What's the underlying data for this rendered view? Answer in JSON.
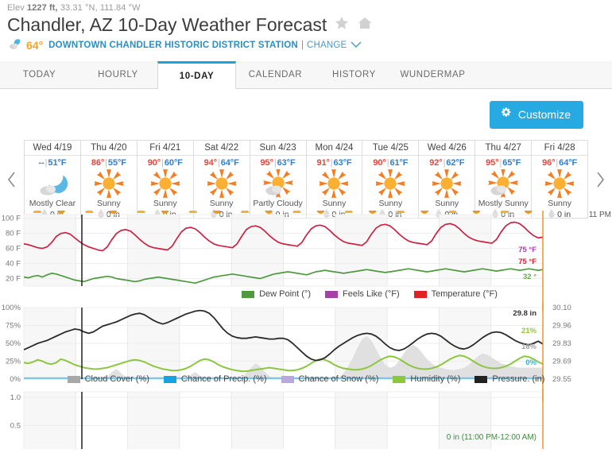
{
  "header": {
    "elev_prefix": "Elev",
    "elev_value": "1227 ft,",
    "coords": "33.31 °N, 111.84 °W",
    "title": "Chandler, AZ 10-Day Weather Forecast",
    "star_icon": "star-icon",
    "home_icon": "home-icon",
    "current_temp": "64°",
    "station_name": "DOWNTOWN CHANDLER HISTORIC DISTRICT STATION",
    "pipe": "|",
    "change_label": "CHANGE",
    "current_icon": "moon-cloud-icon"
  },
  "tabs": [
    {
      "label": "TODAY",
      "active": false
    },
    {
      "label": "HOURLY",
      "active": false
    },
    {
      "label": "10-DAY",
      "active": true
    },
    {
      "label": "CALENDAR",
      "active": false
    },
    {
      "label": "HISTORY",
      "active": false
    },
    {
      "label": "WUNDERMAP",
      "active": false
    }
  ],
  "toolbar": {
    "customize_label": "Customize",
    "gear_icon": "gear-icon"
  },
  "forecast": {
    "prev_label": "‹",
    "next_label": "›",
    "now_label": "11 PM",
    "days": [
      {
        "name": "Wed 4/19",
        "high": "--",
        "low": "51°F",
        "cond": "Mostly Clear",
        "precip": "0 in",
        "icon": "moon-cloud-icon",
        "high_na": true
      },
      {
        "name": "Thu 4/20",
        "high": "86°",
        "low": "55°F",
        "cond": "Sunny",
        "precip": "0 in",
        "icon": "sun-icon",
        "high_na": false
      },
      {
        "name": "Fri 4/21",
        "high": "90°",
        "low": "60°F",
        "cond": "Sunny",
        "precip": "0 in",
        "icon": "sun-icon",
        "high_na": false
      },
      {
        "name": "Sat 4/22",
        "high": "94°",
        "low": "64°F",
        "cond": "Sunny",
        "precip": "0 in",
        "icon": "sun-icon",
        "high_na": false
      },
      {
        "name": "Sun 4/23",
        "high": "95°",
        "low": "63°F",
        "cond": "Partly Cloudy",
        "precip": "0 in",
        "icon": "sun-cloud-icon",
        "high_na": false
      },
      {
        "name": "Mon 4/24",
        "high": "91°",
        "low": "63°F",
        "cond": "Sunny",
        "precip": "0 in",
        "icon": "sun-icon",
        "high_na": false
      },
      {
        "name": "Tue 4/25",
        "high": "90°",
        "low": "61°F",
        "cond": "Sunny",
        "precip": "0 in",
        "icon": "sun-icon",
        "high_na": false
      },
      {
        "name": "Wed 4/26",
        "high": "92°",
        "low": "62°F",
        "cond": "Sunny",
        "precip": "0 in",
        "icon": "sun-icon",
        "high_na": false
      },
      {
        "name": "Thu 4/27",
        "high": "95°",
        "low": "65°F",
        "cond": "Mostly Sunny",
        "precip": "0 in",
        "icon": "sun-cloud-icon",
        "high_na": false
      },
      {
        "name": "Fri 4/28",
        "high": "96°",
        "low": "64°F",
        "cond": "Sunny",
        "precip": "0 in",
        "icon": "sun-icon",
        "high_na": false
      }
    ]
  },
  "chart_data": [
    {
      "id": "temperature",
      "type": "line",
      "title": "",
      "xlabel": "",
      "ylabel": "",
      "ylim": [
        10,
        105
      ],
      "yticks": [
        "100 F",
        "80 F",
        "60 F",
        "40 F",
        "20 F"
      ],
      "ytick_values": [
        100,
        80,
        60,
        40,
        20
      ],
      "grid": true,
      "legend_position": "bottom",
      "legend": [
        {
          "name": "Dew Point (°)",
          "color": "#4e9a3e"
        },
        {
          "name": "Feels Like (°F)",
          "color": "#a83fa8"
        },
        {
          "name": "Temperature (°F)",
          "color": "#e02222"
        }
      ],
      "end_labels": [
        {
          "text": "75 °F",
          "color": "#a83fa8",
          "series": "Feels Like (°F)"
        },
        {
          "text": "75 °F",
          "color": "#d02030",
          "series": "Temperature (°F)"
        },
        {
          "text": "32 °",
          "color": "#6aa84f",
          "series": "Dew Point (°)"
        }
      ],
      "series": [
        {
          "name": "Temperature (°F)",
          "color": "#cc2244",
          "values": [
            66,
            65,
            63,
            61,
            60,
            62,
            68,
            76,
            80,
            81,
            79,
            74,
            69,
            65,
            62,
            60,
            58,
            57,
            62,
            72,
            80,
            84,
            85,
            83,
            78,
            72,
            67,
            63,
            61,
            60,
            59,
            58,
            63,
            73,
            82,
            87,
            88,
            86,
            81,
            75,
            70,
            66,
            64,
            63,
            62,
            61,
            66,
            76,
            85,
            89,
            90,
            88,
            83,
            77,
            72,
            68,
            66,
            65,
            64,
            63,
            68,
            78,
            86,
            90,
            91,
            89,
            84,
            78,
            73,
            69,
            67,
            66,
            65,
            64,
            69,
            79,
            87,
            91,
            92,
            90,
            85,
            79,
            74,
            70,
            68,
            67,
            66,
            65,
            70,
            80,
            88,
            92,
            93,
            91,
            86,
            80,
            75,
            72,
            70,
            69,
            68,
            67,
            72,
            82,
            90,
            94,
            95,
            93,
            88,
            82,
            77,
            74,
            75
          ]
        },
        {
          "name": "Dew Point (°)",
          "color": "#4e9a3e",
          "values": [
            22,
            21,
            23,
            24,
            22,
            25,
            27,
            26,
            24,
            22,
            20,
            18,
            17,
            16,
            18,
            20,
            21,
            22,
            23,
            22,
            20,
            19,
            18,
            17,
            16,
            17,
            19,
            20,
            21,
            22,
            21,
            20,
            19,
            18,
            17,
            16,
            15,
            14,
            16,
            18,
            20,
            22,
            23,
            24,
            25,
            26,
            25,
            24,
            23,
            22,
            21,
            20,
            22,
            24,
            26,
            27,
            28,
            29,
            28,
            27,
            26,
            25,
            27,
            29,
            30,
            31,
            30,
            29,
            28,
            27,
            28,
            29,
            30,
            31,
            32,
            31,
            30,
            29,
            28,
            29,
            30,
            31,
            32,
            33,
            32,
            31,
            30,
            29,
            30,
            31,
            32,
            33,
            32,
            31,
            30,
            29,
            30,
            31,
            32,
            33,
            32,
            31,
            30,
            31,
            32,
            33,
            32,
            31,
            32,
            33,
            32,
            31,
            32
          ]
        }
      ]
    },
    {
      "id": "conditions",
      "type": "line",
      "title": "",
      "ylim": [
        0,
        100
      ],
      "yticks": [
        "100%",
        "75%",
        "50%",
        "25%",
        "0%"
      ],
      "ytick_values": [
        100,
        75,
        50,
        25,
        0
      ],
      "y2ticks": [
        "30.10",
        "29.96",
        "29.83",
        "29.69",
        "29.55"
      ],
      "y2tick_values": [
        30.1,
        29.96,
        29.83,
        29.69,
        29.55
      ],
      "grid": true,
      "legend_position": "bottom",
      "legend": [
        {
          "name": "Cloud Cover (%)",
          "color": "#a8a8a8"
        },
        {
          "name": "Chance of Precip. (%)",
          "color": "#17a3dc"
        },
        {
          "name": "Chance of Snow (%)",
          "color": "#b9a8e0"
        },
        {
          "name": "Humidity (%)",
          "color": "#8dc63f"
        },
        {
          "name": "Pressure. (in)",
          "color": "#222222"
        }
      ],
      "end_labels": [
        {
          "text": "29.8 in",
          "color": "#333333",
          "series": "Pressure. (in)"
        },
        {
          "text": "21%",
          "color": "#8dc63f",
          "series": "Humidity (%)"
        },
        {
          "text": "16%",
          "color": "#a0a0a0",
          "series": "Cloud Cover (%)"
        },
        {
          "text": "0%",
          "color": "#29b6e8",
          "series": "Chance of Precip. (%)"
        }
      ],
      "series": [
        {
          "name": "Pressure. (in)",
          "color": "#333333",
          "values": [
            41,
            44,
            47,
            50,
            52,
            54,
            57,
            60,
            63,
            66,
            68,
            70,
            69,
            66,
            64,
            66,
            70,
            74,
            76,
            78,
            80,
            83,
            86,
            89,
            91,
            92,
            90,
            86,
            82,
            79,
            77,
            79,
            82,
            85,
            88,
            91,
            93,
            95,
            96,
            95,
            92,
            86,
            78,
            70,
            64,
            60,
            58,
            57,
            57,
            58,
            59,
            58,
            57,
            56,
            56,
            57,
            57,
            55,
            50,
            44,
            38,
            32,
            28,
            26,
            27,
            30,
            35,
            41,
            46,
            50,
            54,
            58,
            61,
            63,
            64,
            63,
            60,
            55,
            49,
            44,
            41,
            40,
            42,
            46,
            51,
            56,
            60,
            63,
            64,
            63,
            60,
            55,
            50,
            46,
            43,
            42,
            44,
            48,
            53,
            58,
            62,
            65,
            66,
            65,
            62,
            58,
            54,
            51,
            49,
            48,
            50,
            53,
            49
          ]
        },
        {
          "name": "Humidity (%)",
          "color": "#8dc63f",
          "values": [
            23,
            22,
            24,
            27,
            25,
            22,
            21,
            23,
            28,
            26,
            23,
            20,
            18,
            16,
            15,
            14,
            14,
            15,
            16,
            18,
            20,
            22,
            24,
            26,
            27,
            26,
            24,
            21,
            18,
            16,
            14,
            13,
            12,
            12,
            13,
            15,
            18,
            22,
            26,
            28,
            27,
            24,
            20,
            17,
            15,
            13,
            12,
            11,
            11,
            12,
            13,
            14,
            15,
            16,
            15,
            14,
            13,
            12,
            12,
            13,
            15,
            18,
            22,
            26,
            28,
            27,
            24,
            20,
            17,
            15,
            14,
            13,
            13,
            14,
            16,
            19,
            23,
            27,
            30,
            32,
            31,
            28,
            24,
            20,
            17,
            15,
            14,
            14,
            15,
            17,
            20,
            24,
            28,
            31,
            33,
            32,
            29,
            25,
            21,
            18,
            16,
            15,
            15,
            16,
            18,
            21,
            25,
            29,
            32,
            31,
            28,
            24,
            21
          ]
        },
        {
          "name": "Cloud Cover (%)",
          "color": "#c4c4c4",
          "values": [
            0,
            0,
            0,
            0,
            0,
            0,
            0,
            0,
            0,
            0,
            0,
            0,
            0,
            0,
            0,
            0,
            0,
            0,
            3,
            10,
            14,
            8,
            3,
            0,
            0,
            0,
            0,
            0,
            0,
            0,
            0,
            0,
            0,
            0,
            0,
            2,
            6,
            10,
            5,
            2,
            0,
            0,
            0,
            0,
            0,
            0,
            0,
            2,
            8,
            16,
            22,
            18,
            10,
            4,
            0,
            0,
            0,
            0,
            0,
            0,
            0,
            0,
            0,
            0,
            0,
            0,
            0,
            0,
            2,
            8,
            18,
            30,
            44,
            56,
            60,
            54,
            42,
            30,
            20,
            16,
            18,
            26,
            36,
            44,
            48,
            44,
            36,
            28,
            22,
            18,
            16,
            14,
            13,
            13,
            14,
            16,
            20,
            26,
            32,
            36,
            34,
            30,
            26,
            22,
            20,
            18,
            17,
            16,
            16,
            16,
            16,
            16,
            16
          ]
        },
        {
          "name": "Chance of Precip. (%)",
          "color": "#7cc7e8",
          "values": [
            0,
            0,
            0,
            0,
            0,
            0,
            0,
            0,
            0,
            0,
            0,
            0,
            0,
            0,
            0,
            0,
            0,
            0,
            0,
            0,
            0,
            0,
            0,
            0,
            0,
            0,
            0,
            0,
            0,
            0,
            0,
            0,
            0,
            0,
            0,
            0,
            0,
            0,
            0,
            0,
            0,
            0,
            0,
            0,
            0,
            0,
            0,
            0,
            0,
            0,
            0,
            0,
            0,
            0,
            0,
            0,
            0,
            0,
            0,
            0,
            0,
            0,
            0,
            0,
            0,
            0,
            0,
            0,
            0,
            0,
            0,
            0,
            0,
            0,
            0,
            0,
            0,
            0,
            0,
            0,
            0,
            0,
            0,
            0,
            0,
            0,
            0,
            0,
            0,
            0,
            0,
            0,
            0,
            0,
            0,
            0,
            0,
            0,
            0,
            0,
            0,
            0,
            0,
            0,
            0,
            0,
            0,
            0,
            0,
            0,
            0,
            0,
            0
          ]
        }
      ]
    },
    {
      "id": "precip-amount",
      "type": "line",
      "ylim": [
        0,
        1.1
      ],
      "yticks": [
        "1.0",
        "0.5"
      ],
      "ytick_values": [
        1.0,
        0.5
      ],
      "grid": true,
      "tooltip": "0 in (11:00 PM-12:00 AM)",
      "series": [
        {
          "name": "Precipitation (in)",
          "color": "#8dc63f",
          "values": []
        }
      ]
    }
  ]
}
